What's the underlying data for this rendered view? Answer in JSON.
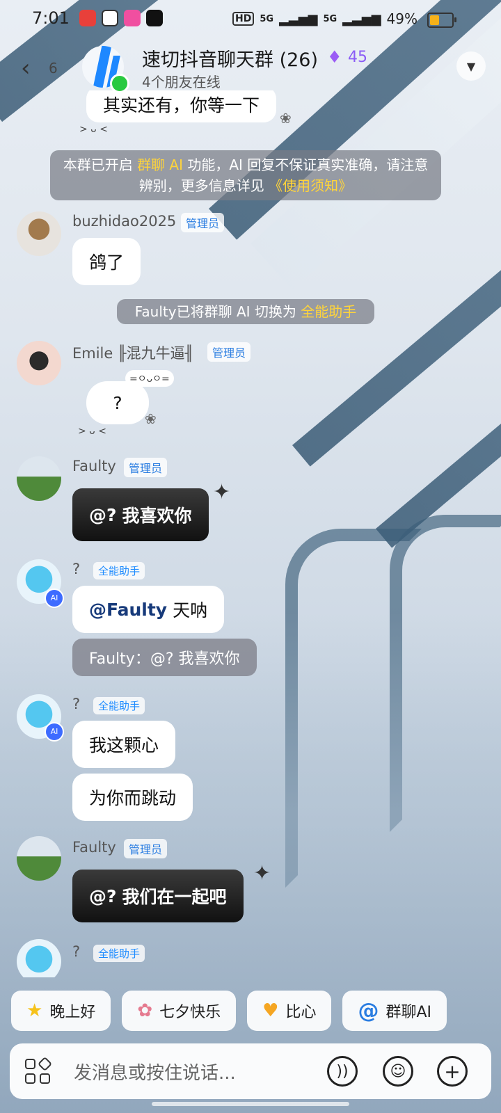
{
  "status_bar": {
    "time": "7:01",
    "network_1": "HD",
    "network_2": "5G",
    "network_3": "5G",
    "battery_text": "49%",
    "battery_level": 0.49
  },
  "header": {
    "back_count": "6",
    "title": "速切抖音聊天群 (26)",
    "fire_count": "45",
    "subtitle": "4个朋友在线"
  },
  "messages": {
    "partial_top": "其实还有，你等一下",
    "notice_ai": {
      "pre": "本群已开启",
      "hl": "群聊 AI",
      "mid": "功能，AI 回复不保证真实准确，请注意辨别，更多信息详见",
      "link": "《使用须知》"
    },
    "m1": {
      "name": "buzhidao2025",
      "badge": "管理员",
      "text": "鸽了"
    },
    "notice_switch": {
      "pre": "Faulty已将群聊 AI 切换为",
      "hl": "全能助手"
    },
    "m2": {
      "name": "Emile ╟混九牛逼╢",
      "badge": "管理员",
      "text": "?"
    },
    "m3": {
      "name": "Faulty",
      "badge": "管理员",
      "mention": "@?",
      "text": "我喜欢你"
    },
    "m4": {
      "name": "?",
      "badge": "全能助手",
      "mention": "@Faulty",
      "text": "天呐",
      "quote": "Faulty：@?  我喜欢你"
    },
    "m5": {
      "name": "?",
      "badge": "全能助手",
      "text1": "我这颗心",
      "text2": "为你而跳动"
    },
    "m6": {
      "name": "Faulty",
      "badge": "管理员",
      "mention": "@?",
      "text": "我们在一起吧"
    },
    "m7": {
      "name": "?",
      "badge": "全能助手"
    }
  },
  "quick_replies": [
    "晚上好",
    "七夕快乐",
    "比心",
    "群聊AI"
  ],
  "input": {
    "placeholder": "发消息或按住说话..."
  },
  "icons": [
    "back-icon",
    "flame-icon",
    "chevron-down-icon",
    "apps-grid-icon",
    "voice-icon",
    "emoji-icon",
    "plus-icon"
  ]
}
